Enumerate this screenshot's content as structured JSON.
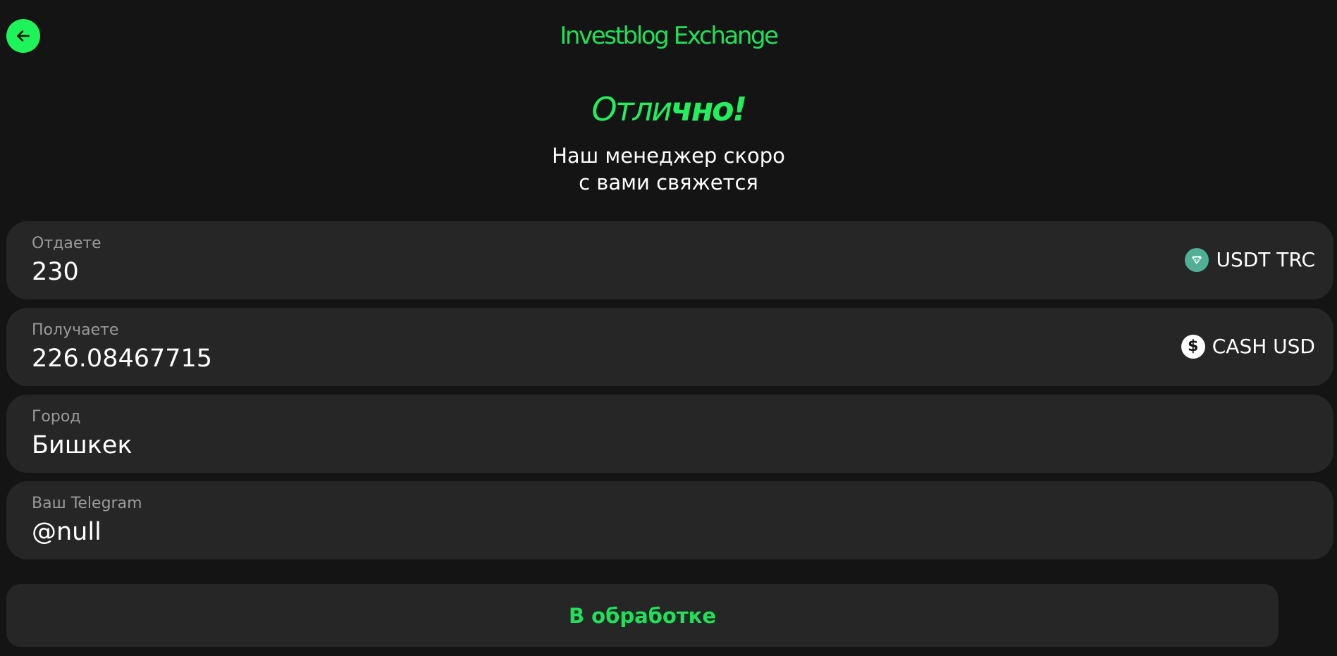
{
  "header": {
    "back_icon": "arrow-left-icon",
    "brand": "Investblog Exchange"
  },
  "success": {
    "headline_light": "Отли",
    "headline_bold": "чно!",
    "subtitle_line1": "Наш менеджер скоро",
    "subtitle_line2": "с вами свяжется"
  },
  "fields": {
    "give": {
      "label": "Отдаете",
      "value": "230",
      "currency": "USDT TRC",
      "currency_icon": "tether-icon",
      "icon_color": "#50af95"
    },
    "receive": {
      "label": "Получаете",
      "value": "226.0846771563",
      "currency": "CASH USD",
      "currency_icon": "dollar-icon",
      "icon_color": "#ffffff"
    },
    "city": {
      "label": "Город",
      "value": "Бишкек"
    },
    "telegram": {
      "label": "Ваш Telegram",
      "value": "@null"
    }
  },
  "status": {
    "label": "В обработке"
  },
  "colors": {
    "accent": "#1ef45a",
    "background": "#141414",
    "card": "#262626"
  }
}
